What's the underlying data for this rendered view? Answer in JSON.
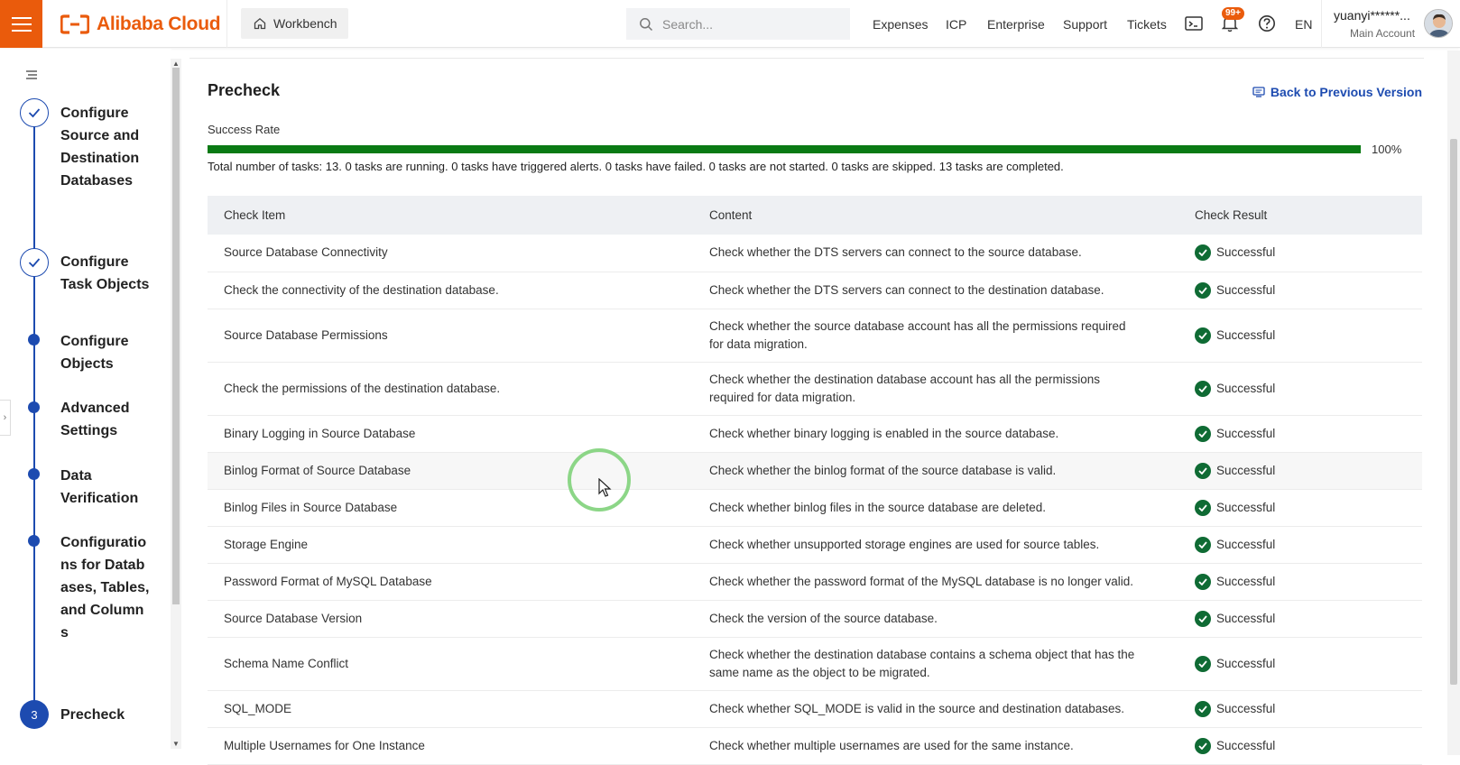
{
  "brand": {
    "name": "Alibaba Cloud",
    "color": "#ea5b0c"
  },
  "topbar": {
    "workbench": "Workbench",
    "search_placeholder": "Search...",
    "nav": [
      "Expenses",
      "ICP",
      "Enterprise",
      "Support",
      "Tickets"
    ],
    "badge": "99+",
    "language": "EN",
    "user_name": "yuanyi******...",
    "user_role": "Main Account"
  },
  "steps": [
    {
      "label": "Configure Source and Destination Databases",
      "state": "done"
    },
    {
      "label": "Configure Task Objects",
      "state": "done"
    },
    {
      "label": "Configure Objects",
      "state": "pending"
    },
    {
      "label": "Advanced Settings",
      "state": "pending"
    },
    {
      "label": "Data Verification",
      "state": "pending"
    },
    {
      "label": "Configurations for Databases, Tables, and Columns",
      "state": "pending"
    },
    {
      "label": "Precheck",
      "state": "current",
      "number": "3"
    }
  ],
  "main": {
    "title": "Precheck",
    "back_link": "Back to Previous Version",
    "success_rate_label": "Success Rate",
    "success_rate": 100,
    "success_rate_text": "100%",
    "summary": "Total number of tasks: 13. 0 tasks are running. 0 tasks have triggered alerts. 0 tasks have failed. 0 tasks are not started. 0 tasks are skipped. 13 tasks are completed."
  },
  "table": {
    "headers": [
      "Check Item",
      "Content",
      "Check Result"
    ],
    "rows": [
      {
        "item": "Source Database Connectivity",
        "content": "Check whether the DTS servers can connect to the source database.",
        "result": "Successful"
      },
      {
        "item": "Check the connectivity of the destination database.",
        "content": "Check whether the DTS servers can connect to the destination database.",
        "result": "Successful"
      },
      {
        "item": "Source Database Permissions",
        "content": "Check whether the source database account has all the permissions required for data migration.",
        "result": "Successful"
      },
      {
        "item": "Check the permissions of the destination database.",
        "content": "Check whether the destination database account has all the permissions required for data migration.",
        "result": "Successful"
      },
      {
        "item": "Binary Logging in Source Database",
        "content": "Check whether binary logging is enabled in the source database.",
        "result": "Successful"
      },
      {
        "item": "Binlog Format of Source Database",
        "content": "Check whether the binlog format of the source database is valid.",
        "result": "Successful"
      },
      {
        "item": "Binlog Files in Source Database",
        "content": "Check whether binlog files in the source database are deleted.",
        "result": "Successful"
      },
      {
        "item": "Storage Engine",
        "content": "Check whether unsupported storage engines are used for source tables.",
        "result": "Successful"
      },
      {
        "item": "Password Format of MySQL Database",
        "content": "Check whether the password format of the MySQL database is no longer valid.",
        "result": "Successful"
      },
      {
        "item": "Source Database Version",
        "content": "Check the version of the source database.",
        "result": "Successful"
      },
      {
        "item": "Schema Name Conflict",
        "content": "Check whether the destination database contains a schema object that has the same name as the object to be migrated.",
        "result": "Successful"
      },
      {
        "item": "SQL_MODE",
        "content": "Check whether SQL_MODE is valid in the source and destination databases.",
        "result": "Successful"
      },
      {
        "item": "Multiple Usernames for One Instance",
        "content": "Check whether multiple usernames are used for the same instance.",
        "result": "Successful"
      }
    ]
  }
}
